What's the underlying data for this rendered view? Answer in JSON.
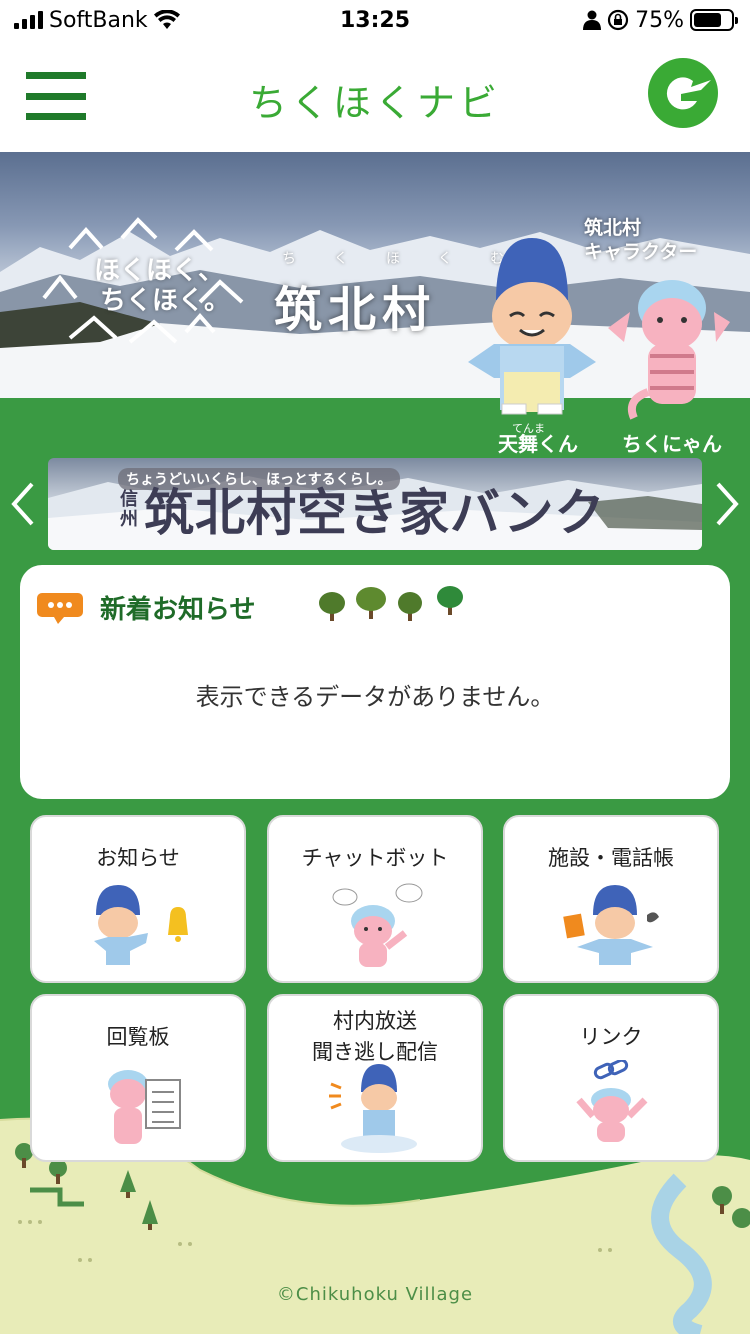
{
  "status": {
    "carrier": "SoftBank",
    "time": "13:25",
    "battery_percent": "75%",
    "battery_level": 0.75
  },
  "header": {
    "title": "ちくほくナビ"
  },
  "hero": {
    "slogan_line1": "ほくほく、",
    "slogan_line2": "ちくほく。",
    "ruby": "ちくほくむら",
    "village_name": "筑北村",
    "caption_line1": "筑北村",
    "caption_line2": "キャラクター",
    "character1_ruby": "てんま",
    "character1_name": "天舞くん",
    "character2_name": "ちくにゃん"
  },
  "banner": {
    "tagline": "ちょうどいいくらし、ほっとするくらし。",
    "prefecture": "信州",
    "title": "筑北村空き家バンク"
  },
  "news": {
    "title": "新着お知らせ",
    "empty_message": "表示できるデータがありません。"
  },
  "menu": {
    "notices": "お知らせ",
    "chatbot": "チャットボット",
    "facilities": "施設・電話帳",
    "circular": "回覧板",
    "broadcast_line1": "村内放送",
    "broadcast_line2": "聞き逃し配信",
    "links": "リンク"
  },
  "footer": {
    "copyright": "©Chikuhoku Village"
  },
  "colors": {
    "brand_green": "#3aaa35",
    "background_green": "#3a9a43",
    "dark_green": "#1f6b28"
  }
}
